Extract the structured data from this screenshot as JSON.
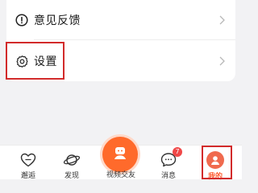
{
  "settings_list": {
    "items": [
      {
        "label": "意见反馈",
        "icon": "info-circle-icon"
      },
      {
        "label": "设置",
        "icon": "gear-icon"
      }
    ]
  },
  "tabbar": {
    "tabs": [
      {
        "label": "邂逅",
        "icon": "heart-icon"
      },
      {
        "label": "发现",
        "icon": "planet-icon"
      },
      {
        "label": "视频交友",
        "icon": "video-match-icon"
      },
      {
        "label": "消息",
        "icon": "chat-bubble-icon",
        "badge": "7"
      },
      {
        "label": "我的",
        "icon": "profile-avatar-icon",
        "active": true
      }
    ]
  },
  "colors": {
    "accent": "#ff5a2e",
    "highlight": "#d22b2b",
    "badge": "#f04848"
  }
}
